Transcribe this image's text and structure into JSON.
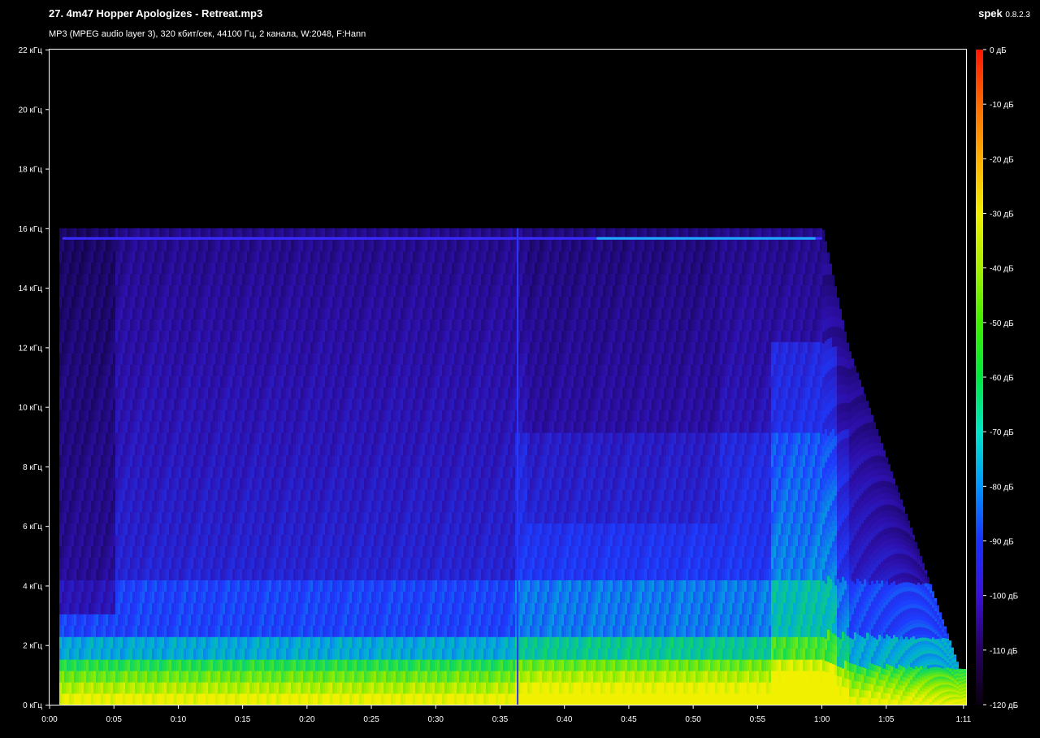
{
  "header": {
    "file_title": "27. 4m47 Hopper Apologizes - Retreat.mp3",
    "info": "MP3 (MPEG audio layer 3), 320 кбит/сек, 44100 Гц, 2 канала, W:2048, F:Hann",
    "app_name": "spek",
    "app_version": "0.8.2.3"
  },
  "frequency_axis": {
    "labels": [
      "0 кГц",
      "2 кГц",
      "4 кГц",
      "6 кГц",
      "8 кГц",
      "10 кГц",
      "12 кГц",
      "14 кГц",
      "16 кГц",
      "18 кГц",
      "20 кГц",
      "22 кГц"
    ]
  },
  "time_axis": {
    "labels": [
      "0:00",
      "0:05",
      "0:10",
      "0:15",
      "0:20",
      "0:25",
      "0:30",
      "0:35",
      "0:40",
      "0:45",
      "0:50",
      "0:55",
      "1:00",
      "1:05",
      "1:11"
    ]
  },
  "color_scale": {
    "labels": [
      "0 дБ",
      "-10 дБ",
      "-20 дБ",
      "-30 дБ",
      "-40 дБ",
      "-50 дБ",
      "-60 дБ",
      "-70 дБ",
      "-80 дБ",
      "-90 дБ",
      "-100 дБ",
      "-110 дБ",
      "-120 дБ"
    ],
    "colors": [
      "#ff1500",
      "#ff6a00",
      "#ffb000",
      "#f2ee00",
      "#a6f000",
      "#40ee00",
      "#00e840",
      "#00e6c8",
      "#0096ff",
      "#1a30ff",
      "#3a10d8",
      "#250060",
      "#0a0010"
    ]
  }
}
